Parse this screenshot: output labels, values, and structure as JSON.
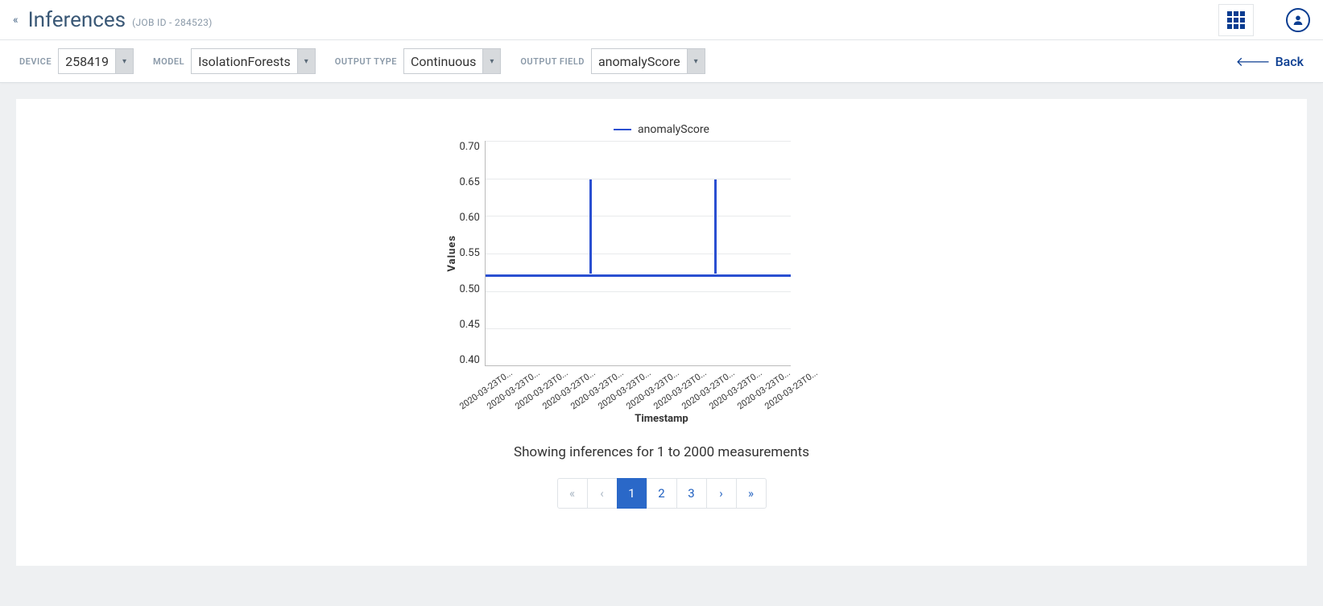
{
  "header": {
    "title": "Inferences",
    "subtitle": "(JOB ID - 284523)"
  },
  "filters": {
    "device": {
      "label": "DEVICE",
      "value": "258419"
    },
    "model": {
      "label": "MODEL",
      "value": "IsolationForests"
    },
    "output_type": {
      "label": "OUTPUT TYPE",
      "value": "Continuous"
    },
    "output_field": {
      "label": "OUTPUT FIELD",
      "value": "anomalyScore"
    }
  },
  "back_label": "Back",
  "chart": {
    "legend": "anomalyScore",
    "y_label": "Values",
    "x_label": "Timestamp",
    "y_ticks": [
      "0.70",
      "0.65",
      "0.60",
      "0.55",
      "0.50",
      "0.45",
      "0.40"
    ],
    "x_tick": "2020-03-23T0..."
  },
  "summary": "Showing inferences for 1 to 2000 measurements",
  "pagination": {
    "first": "«",
    "prev": "‹",
    "pages": [
      "1",
      "2",
      "3"
    ],
    "next": "›",
    "last": "»",
    "active_index": 0
  },
  "chart_data": {
    "type": "line",
    "title": "",
    "xlabel": "Timestamp",
    "ylabel": "Values",
    "ylim": [
      0.4,
      0.7
    ],
    "series": [
      {
        "name": "anomalyScore",
        "x_category": "2020-03-23T0...",
        "baseline_value": 0.52,
        "spikes": [
          {
            "position_fraction": 0.34,
            "value": 0.645
          },
          {
            "position_fraction": 0.75,
            "value": 0.645
          }
        ],
        "note": "Values are ~0.52 across the visible window with two narrow spikes to ~0.645."
      }
    ]
  }
}
